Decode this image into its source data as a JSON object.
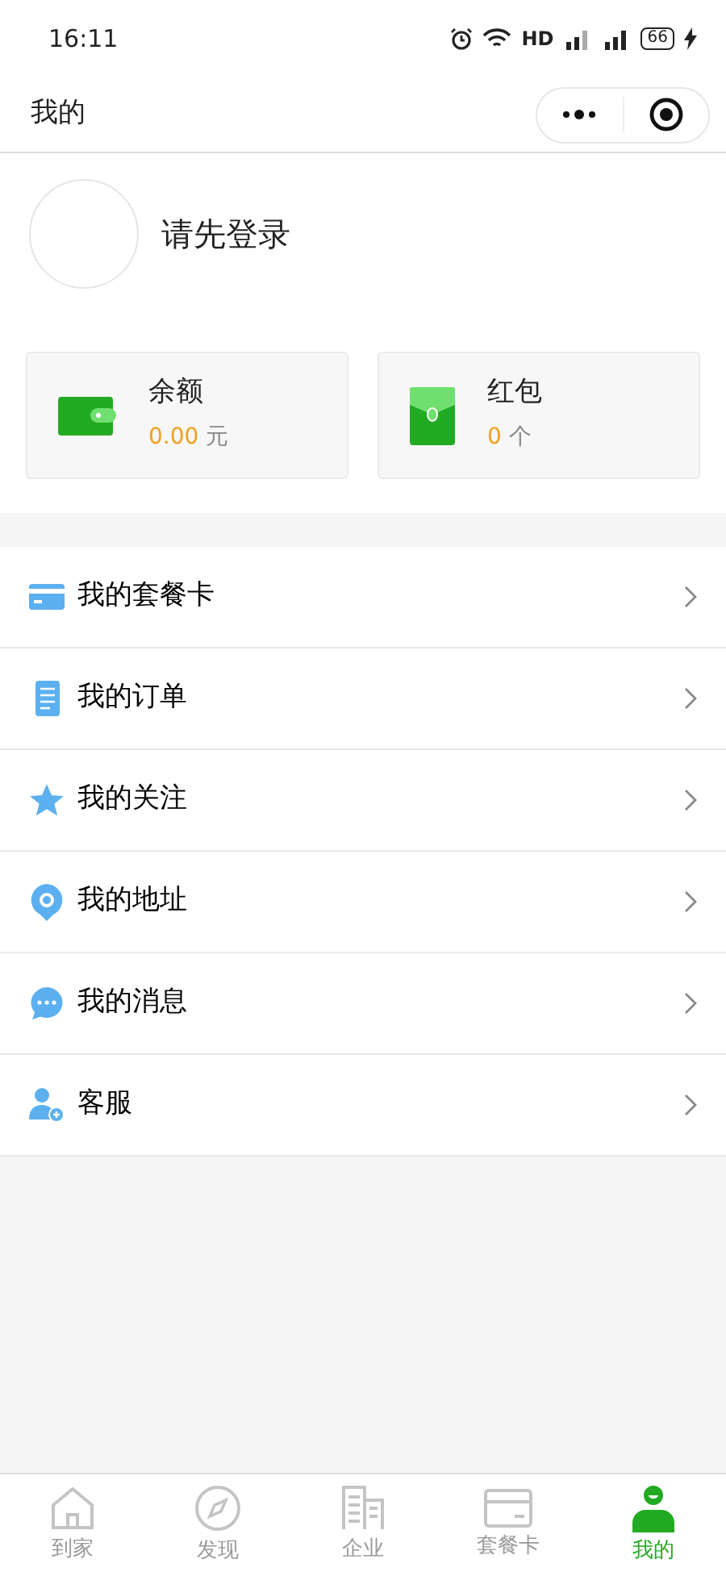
{
  "status_bar": {
    "time": "16:11",
    "network": "HD",
    "battery": "66"
  },
  "header": {
    "title": "我的"
  },
  "profile": {
    "login_prompt": "请先登录"
  },
  "wallet": [
    {
      "kind": "balance",
      "label": "余额",
      "amount": "0.00",
      "unit": "元"
    },
    {
      "kind": "redpacket",
      "label": "红包",
      "amount": "0",
      "unit": "个"
    }
  ],
  "menu": [
    {
      "kind": "card",
      "label": "我的套餐卡"
    },
    {
      "kind": "order",
      "label": "我的订单"
    },
    {
      "kind": "star",
      "label": "我的关注"
    },
    {
      "kind": "pin",
      "label": "我的地址"
    },
    {
      "kind": "chat",
      "label": "我的消息"
    },
    {
      "kind": "user",
      "label": "客服"
    }
  ],
  "tab_bar": [
    {
      "kind": "home",
      "label": "到家",
      "selected": false
    },
    {
      "kind": "compass",
      "label": "发现",
      "selected": false
    },
    {
      "kind": "building",
      "label": "企业",
      "selected": false
    },
    {
      "kind": "card",
      "label": "套餐卡",
      "selected": false
    },
    {
      "kind": "user",
      "label": "我的",
      "selected": true
    }
  ]
}
